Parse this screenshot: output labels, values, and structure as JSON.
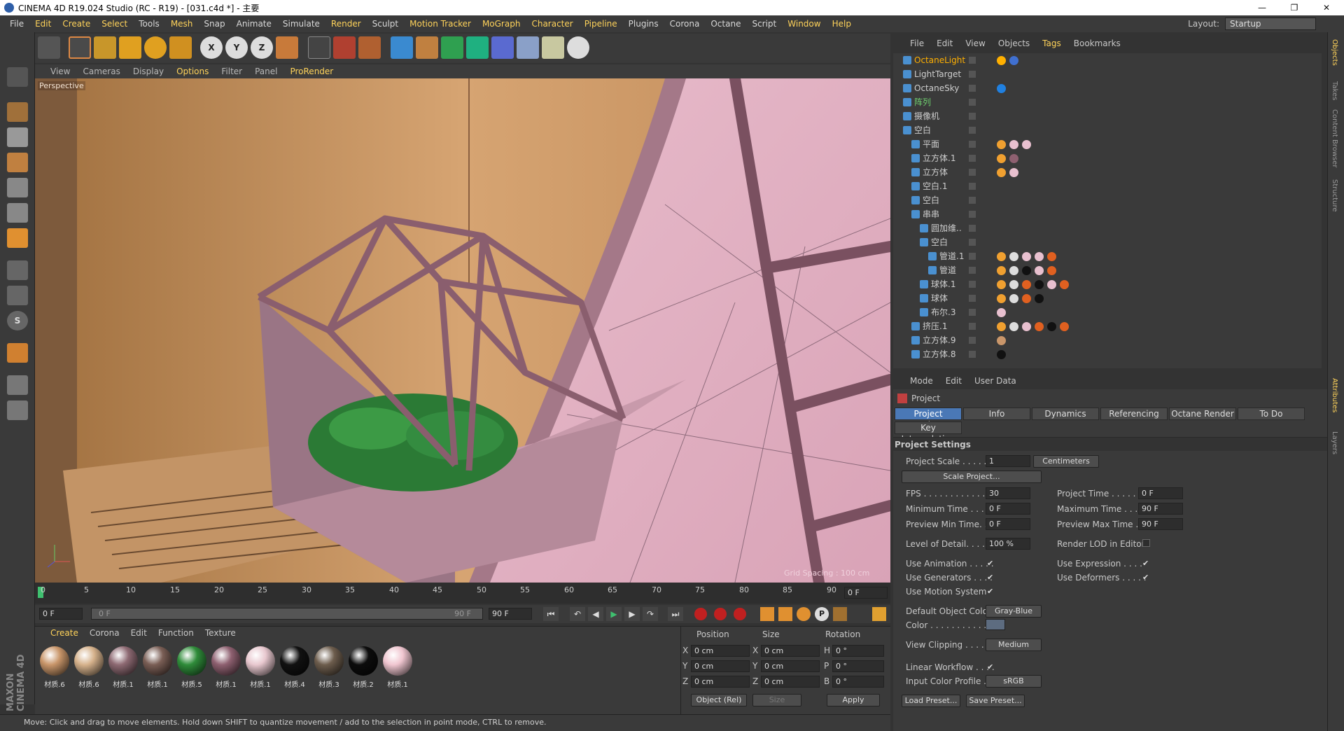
{
  "window": {
    "title": "CINEMA 4D R19.024 Studio (RC - R19) - [031.c4d *] - 主要"
  },
  "menu": [
    "File",
    "Edit",
    "Create",
    "Select",
    "Tools",
    "Mesh",
    "Snap",
    "Animate",
    "Simulate",
    "Render",
    "Sculpt",
    "Motion Tracker",
    "MoGraph",
    "Character",
    "Pipeline",
    "Plugins",
    "Corona",
    "Octane",
    "Script",
    "Window",
    "Help"
  ],
  "layout": {
    "label": "Layout:",
    "value": "Startup"
  },
  "viewport": {
    "menu": [
      "View",
      "Cameras",
      "Display",
      "Options",
      "Filter",
      "Panel",
      "ProRender"
    ],
    "label": "Perspective",
    "grid": "Grid Spacing : 100 cm"
  },
  "timeline": {
    "ticks": [
      "0",
      "5",
      "10",
      "15",
      "20",
      "25",
      "30",
      "35",
      "40",
      "45",
      "50",
      "55",
      "60",
      "65",
      "70",
      "75",
      "80",
      "85",
      "90"
    ],
    "current": "0 F"
  },
  "playbar": {
    "start": "0 F",
    "range_start": "0 F",
    "range_end": "90 F",
    "end": "90 F"
  },
  "materials": {
    "menu": [
      "Create",
      "Corona",
      "Edit",
      "Function",
      "Texture"
    ],
    "items": [
      {
        "name": "材质.6",
        "color": "#c9966a"
      },
      {
        "name": "材质.6",
        "color": "#d6b28c"
      },
      {
        "name": "材质.1",
        "color": "#8e6a73"
      },
      {
        "name": "材质.1",
        "color": "#7a5e55"
      },
      {
        "name": "材质.5",
        "color": "#2f8c3a"
      },
      {
        "name": "材质.1",
        "color": "#8e6070"
      },
      {
        "name": "材质.1",
        "color": "#e8c8cf"
      },
      {
        "name": "材质.4",
        "color": "#111111"
      },
      {
        "name": "材质.3",
        "color": "#6d5d4d"
      },
      {
        "name": "材质.2",
        "color": "#0c0c0c"
      },
      {
        "name": "材质.1",
        "color": "#f0c6d0"
      }
    ]
  },
  "coords": {
    "headers": [
      "Position",
      "Size",
      "Rotation"
    ],
    "rows": [
      {
        "axis": "X",
        "pos": "0 cm",
        "sizeaxis": "X",
        "size": "0 cm",
        "rotaxis": "H",
        "rot": "0 °"
      },
      {
        "axis": "Y",
        "pos": "0 cm",
        "sizeaxis": "Y",
        "size": "0 cm",
        "rotaxis": "P",
        "rot": "0 °"
      },
      {
        "axis": "Z",
        "pos": "0 cm",
        "sizeaxis": "Z",
        "size": "0 cm",
        "rotaxis": "B",
        "rot": "0 °"
      }
    ],
    "mode": "Object (Rel)",
    "size_mode": "Size",
    "apply": "Apply"
  },
  "status": "Move: Click and drag to move elements. Hold down SHIFT to quantize movement / add to the selection in point mode, CTRL to remove.",
  "objects": {
    "menu": [
      "File",
      "Edit",
      "View",
      "Objects",
      "Tags",
      "Bookmarks"
    ],
    "rows": [
      {
        "name": "OctaneLight",
        "indent": 0,
        "color": "#ffb000"
      },
      {
        "name": "LightTarget",
        "indent": 0,
        "color": "#cfcfcf"
      },
      {
        "name": "OctaneSky",
        "indent": 0,
        "color": "#cfcfcf"
      },
      {
        "name": "阵列",
        "indent": 0,
        "color": "#6fcf6f"
      },
      {
        "name": "摄像机",
        "indent": 0,
        "color": "#cfcfcf"
      },
      {
        "name": "空白",
        "indent": 0,
        "color": "#cfcfcf"
      },
      {
        "name": "平面",
        "indent": 1,
        "color": "#cfcfcf"
      },
      {
        "name": "立方体.1",
        "indent": 1,
        "color": "#cfcfcf"
      },
      {
        "name": "立方体",
        "indent": 1,
        "color": "#cfcfcf"
      },
      {
        "name": "空白.1",
        "indent": 1,
        "color": "#cfcfcf"
      },
      {
        "name": "空白",
        "indent": 1,
        "color": "#cfcfcf"
      },
      {
        "name": "串串",
        "indent": 1,
        "color": "#cfcfcf"
      },
      {
        "name": "圆加维..",
        "indent": 2,
        "color": "#cfcfcf"
      },
      {
        "name": "空白",
        "indent": 2,
        "color": "#cfcfcf"
      },
      {
        "name": "管道.1",
        "indent": 3,
        "color": "#cfcfcf"
      },
      {
        "name": "管道",
        "indent": 3,
        "color": "#cfcfcf"
      },
      {
        "name": "球体.1",
        "indent": 2,
        "color": "#cfcfcf"
      },
      {
        "name": "球体",
        "indent": 2,
        "color": "#cfcfcf"
      },
      {
        "name": "布尔.3",
        "indent": 2,
        "color": "#cfcfcf"
      },
      {
        "name": "挤压.1",
        "indent": 1,
        "color": "#cfcfcf"
      },
      {
        "name": "立方体.9",
        "indent": 1,
        "color": "#cfcfcf"
      },
      {
        "name": "立方体.8",
        "indent": 1,
        "color": "#cfcfcf"
      }
    ]
  },
  "attributes": {
    "menu": [
      "Mode",
      "Edit",
      "User Data"
    ],
    "title": "Project",
    "tabs": [
      "Project Settings",
      "Info",
      "Dynamics",
      "Referencing",
      "Octane Render",
      "To Do"
    ],
    "tab2": "Key Interpolation",
    "section": "Project Settings",
    "project_scale_label": "Project Scale . . . . . .",
    "project_scale": "1",
    "units": "Centimeters",
    "scale_btn": "Scale Project...",
    "fps_label": "FPS . . . . . . . . . . . . . .",
    "fps": "30",
    "ptime_label": "Project Time . . . . . .",
    "ptime": "0 F",
    "mintime_label": "Minimum Time . . . .",
    "mintime": "0 F",
    "maxtime_label": "Maximum Time . . . .",
    "maxtime": "90 F",
    "pmin_label": "Preview Min Time. . .",
    "pmin": "0 F",
    "pmax_label": "Preview Max Time . .",
    "pmax": "90 F",
    "lod_label": "Level of Detail. . . . . .",
    "lod": "100 %",
    "renderlod_label": "Render LOD in Editor",
    "useanim_label": "Use Animation . . . . .",
    "useexpr_label": "Use Expression . . . .",
    "usegen_label": "Use Generators . . . .",
    "usedef_label": "Use Deformers . . . . .",
    "usemotion_label": "Use Motion System",
    "defcolor_label": "Default Object Color",
    "defcolor": "Gray-Blue",
    "color_label": "Color . . . . . . . . . . . . .",
    "clip_label": "View Clipping . . . . . .",
    "clip": "Medium",
    "linear_label": "Linear Workflow . . . .",
    "icp_label": "Input Color Profile . .",
    "icp": "sRGB",
    "load_btn": "Load Preset...",
    "save_btn": "Save Preset..."
  },
  "sidetabs": [
    "Objects",
    "Takes",
    "Content Browser",
    "Structure",
    "Attributes",
    "Layers"
  ]
}
